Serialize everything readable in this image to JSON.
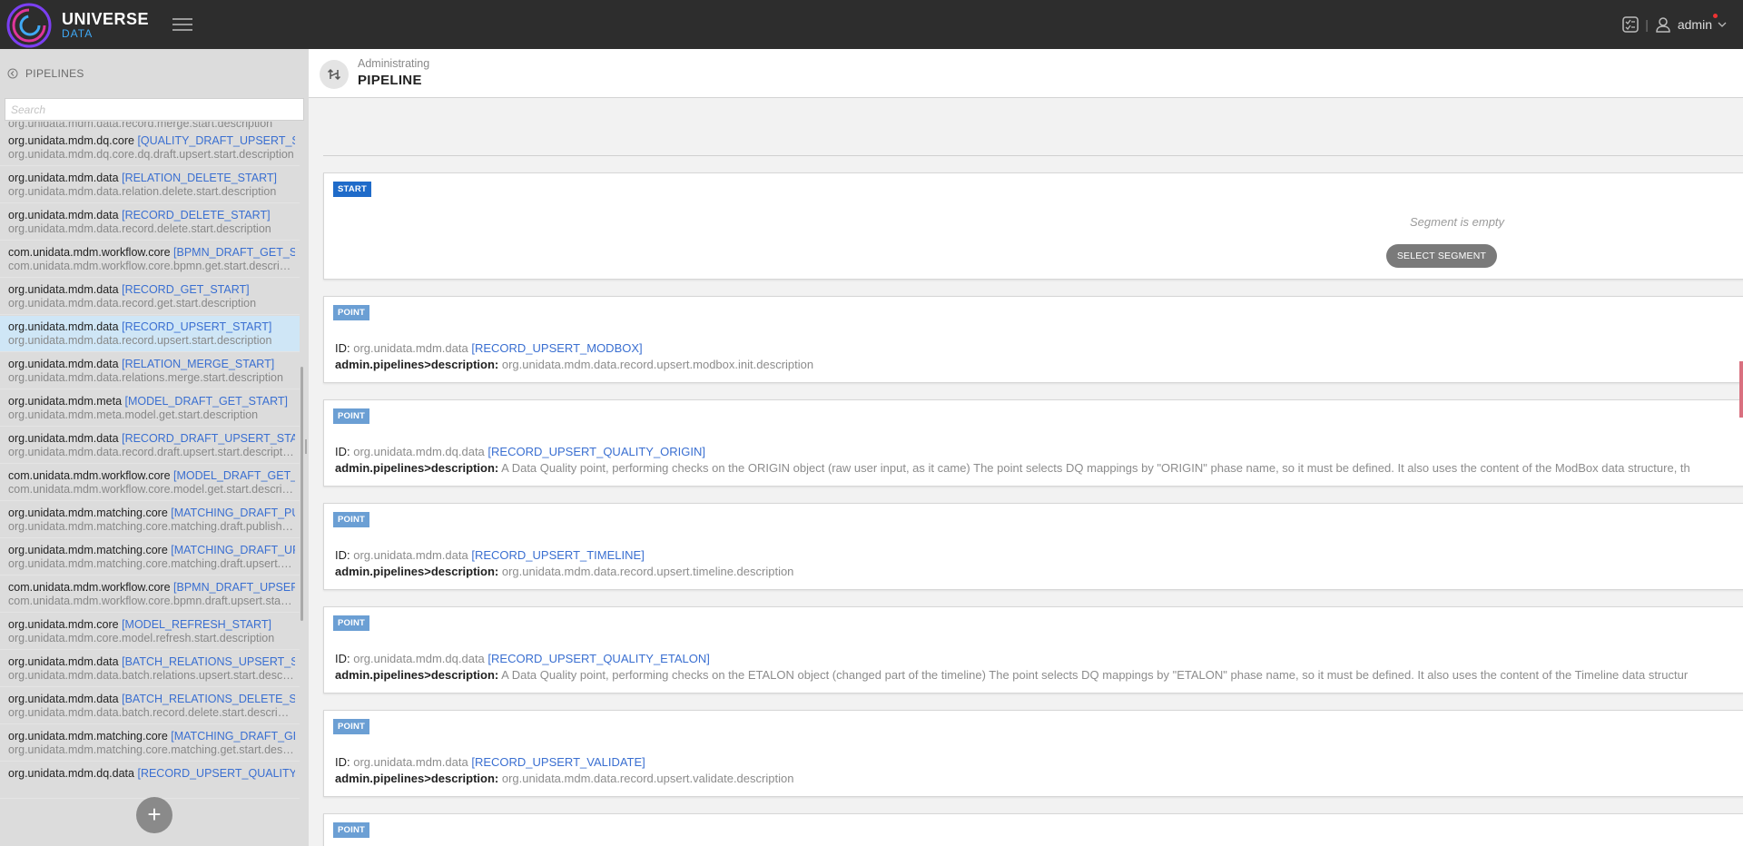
{
  "topbar": {
    "brand_title": "UNIVERSE",
    "brand_subtitle": "DATA",
    "divider": "|",
    "user_name": "admin"
  },
  "sidebar": {
    "header_label": "PIPELINES",
    "search_placeholder": "Search",
    "partial_top_text": "org.unidata.mdm.data.record.merge.start.description",
    "items": [
      {
        "module": "org.unidata.mdm.dq.core",
        "code": "[QUALITY_DRAFT_UPSERT_START]",
        "desc": "org.unidata.mdm.dq.core.dq.draft.upsert.start.description"
      },
      {
        "module": "org.unidata.mdm.data",
        "code": "[RELATION_DELETE_START]",
        "desc": "org.unidata.mdm.data.relation.delete.start.description"
      },
      {
        "module": "org.unidata.mdm.data",
        "code": "[RECORD_DELETE_START]",
        "desc": "org.unidata.mdm.data.record.delete.start.description"
      },
      {
        "module": "com.unidata.mdm.workflow.core",
        "code": "[BPMN_DRAFT_GET_START]",
        "desc": "com.unidata.mdm.workflow.core.bpmn.get.start.description"
      },
      {
        "module": "org.unidata.mdm.data",
        "code": "[RECORD_GET_START]",
        "desc": "org.unidata.mdm.data.record.get.start.description"
      },
      {
        "module": "org.unidata.mdm.data",
        "code": "[RECORD_UPSERT_START]",
        "desc": "org.unidata.mdm.data.record.upsert.start.description"
      },
      {
        "module": "org.unidata.mdm.data",
        "code": "[RELATION_MERGE_START]",
        "desc": "org.unidata.mdm.data.relations.merge.start.description"
      },
      {
        "module": "org.unidata.mdm.meta",
        "code": "[MODEL_DRAFT_GET_START]",
        "desc": "org.unidata.mdm.meta.model.get.start.description"
      },
      {
        "module": "org.unidata.mdm.data",
        "code": "[RECORD_DRAFT_UPSERT_START]",
        "desc": "org.unidata.mdm.data.record.draft.upsert.start.description"
      },
      {
        "module": "com.unidata.mdm.workflow.core",
        "code": "[MODEL_DRAFT_GET_START]",
        "desc": "com.unidata.mdm.workflow.core.model.get.start.description"
      },
      {
        "module": "org.unidata.mdm.matching.core",
        "code": "[MATCHING_DRAFT_PUBLISH_START]",
        "desc": "org.unidata.mdm.matching.core.matching.draft.publish.start.description"
      },
      {
        "module": "org.unidata.mdm.matching.core",
        "code": "[MATCHING_DRAFT_UPSERT_START]",
        "desc": "org.unidata.mdm.matching.core.matching.draft.upsert.start.description"
      },
      {
        "module": "com.unidata.mdm.workflow.core",
        "code": "[BPMN_DRAFT_UPSERT_START]",
        "desc": "com.unidata.mdm.workflow.core.bpmn.draft.upsert.start.description"
      },
      {
        "module": "org.unidata.mdm.core",
        "code": "[MODEL_REFRESH_START]",
        "desc": "org.unidata.mdm.core.model.refresh.start.description"
      },
      {
        "module": "org.unidata.mdm.data",
        "code": "[BATCH_RELATIONS_UPSERT_START]",
        "desc": "org.unidata.mdm.data.batch.relations.upsert.start.description"
      },
      {
        "module": "org.unidata.mdm.data",
        "code": "[BATCH_RELATIONS_DELETE_START]",
        "desc": "org.unidata.mdm.data.batch.record.delete.start.description"
      },
      {
        "module": "org.unidata.mdm.matching.core",
        "code": "[MATCHING_DRAFT_GET_START]",
        "desc": "org.unidata.mdm.matching.core.matching.get.start.description"
      },
      {
        "module": "org.unidata.mdm.dq.data",
        "code": "[RECORD_UPSERT_QUALITY]",
        "desc": ""
      }
    ],
    "add_label": "+"
  },
  "main": {
    "header_subtitle": "Administrating",
    "header_title": "PIPELINE",
    "start": {
      "tag": "START",
      "empty_text": "Segment is empty",
      "select_button": "SELECT SEGMENT"
    },
    "id_label": "ID:",
    "desc_label": "admin.pipelines>description:",
    "points": [
      {
        "tag": "POINT",
        "module": "org.unidata.mdm.data",
        "code": "[RECORD_UPSERT_MODBOX]",
        "desc": "org.unidata.mdm.data.record.upsert.modbox.init.description"
      },
      {
        "tag": "POINT",
        "module": "org.unidata.mdm.dq.data",
        "code": "[RECORD_UPSERT_QUALITY_ORIGIN]",
        "desc": "A Data Quality point, performing checks on the ORIGIN object (raw user input, as it came) The point selects DQ mappings by \"ORIGIN\" phase name, so it must be defined. It also uses the content of the ModBox data structure, th"
      },
      {
        "tag": "POINT",
        "module": "org.unidata.mdm.data",
        "code": "[RECORD_UPSERT_TIMELINE]",
        "desc": "org.unidata.mdm.data.record.upsert.timeline.description"
      },
      {
        "tag": "POINT",
        "module": "org.unidata.mdm.dq.data",
        "code": "[RECORD_UPSERT_QUALITY_ETALON]",
        "desc": "A Data Quality point, performing checks on the ETALON object (changed part of the timeline) The point selects DQ mappings by \"ETALON\" phase name, so it must be defined. It also uses the content of the Timeline data structur"
      },
      {
        "tag": "POINT",
        "module": "org.unidata.mdm.data",
        "code": "[RECORD_UPSERT_VALIDATE]",
        "desc": "org.unidata.mdm.data.record.upsert.validate.description"
      },
      {
        "tag": "POINT"
      }
    ]
  },
  "colors": {
    "topbar": "#2d2d2d",
    "accent_blue": "#3a6fd1",
    "start_tag": "#1f6bc9",
    "point_tag": "#6b9fd4",
    "active_row": "#cfe6f6",
    "notification": "#e33333"
  },
  "icons": [
    "universe-logo-icon",
    "hamburger-menu-icon",
    "tasks-icon",
    "user-icon",
    "chevron-down-icon",
    "back-arrow-icon",
    "pipeline-icon",
    "plus-icon"
  ]
}
